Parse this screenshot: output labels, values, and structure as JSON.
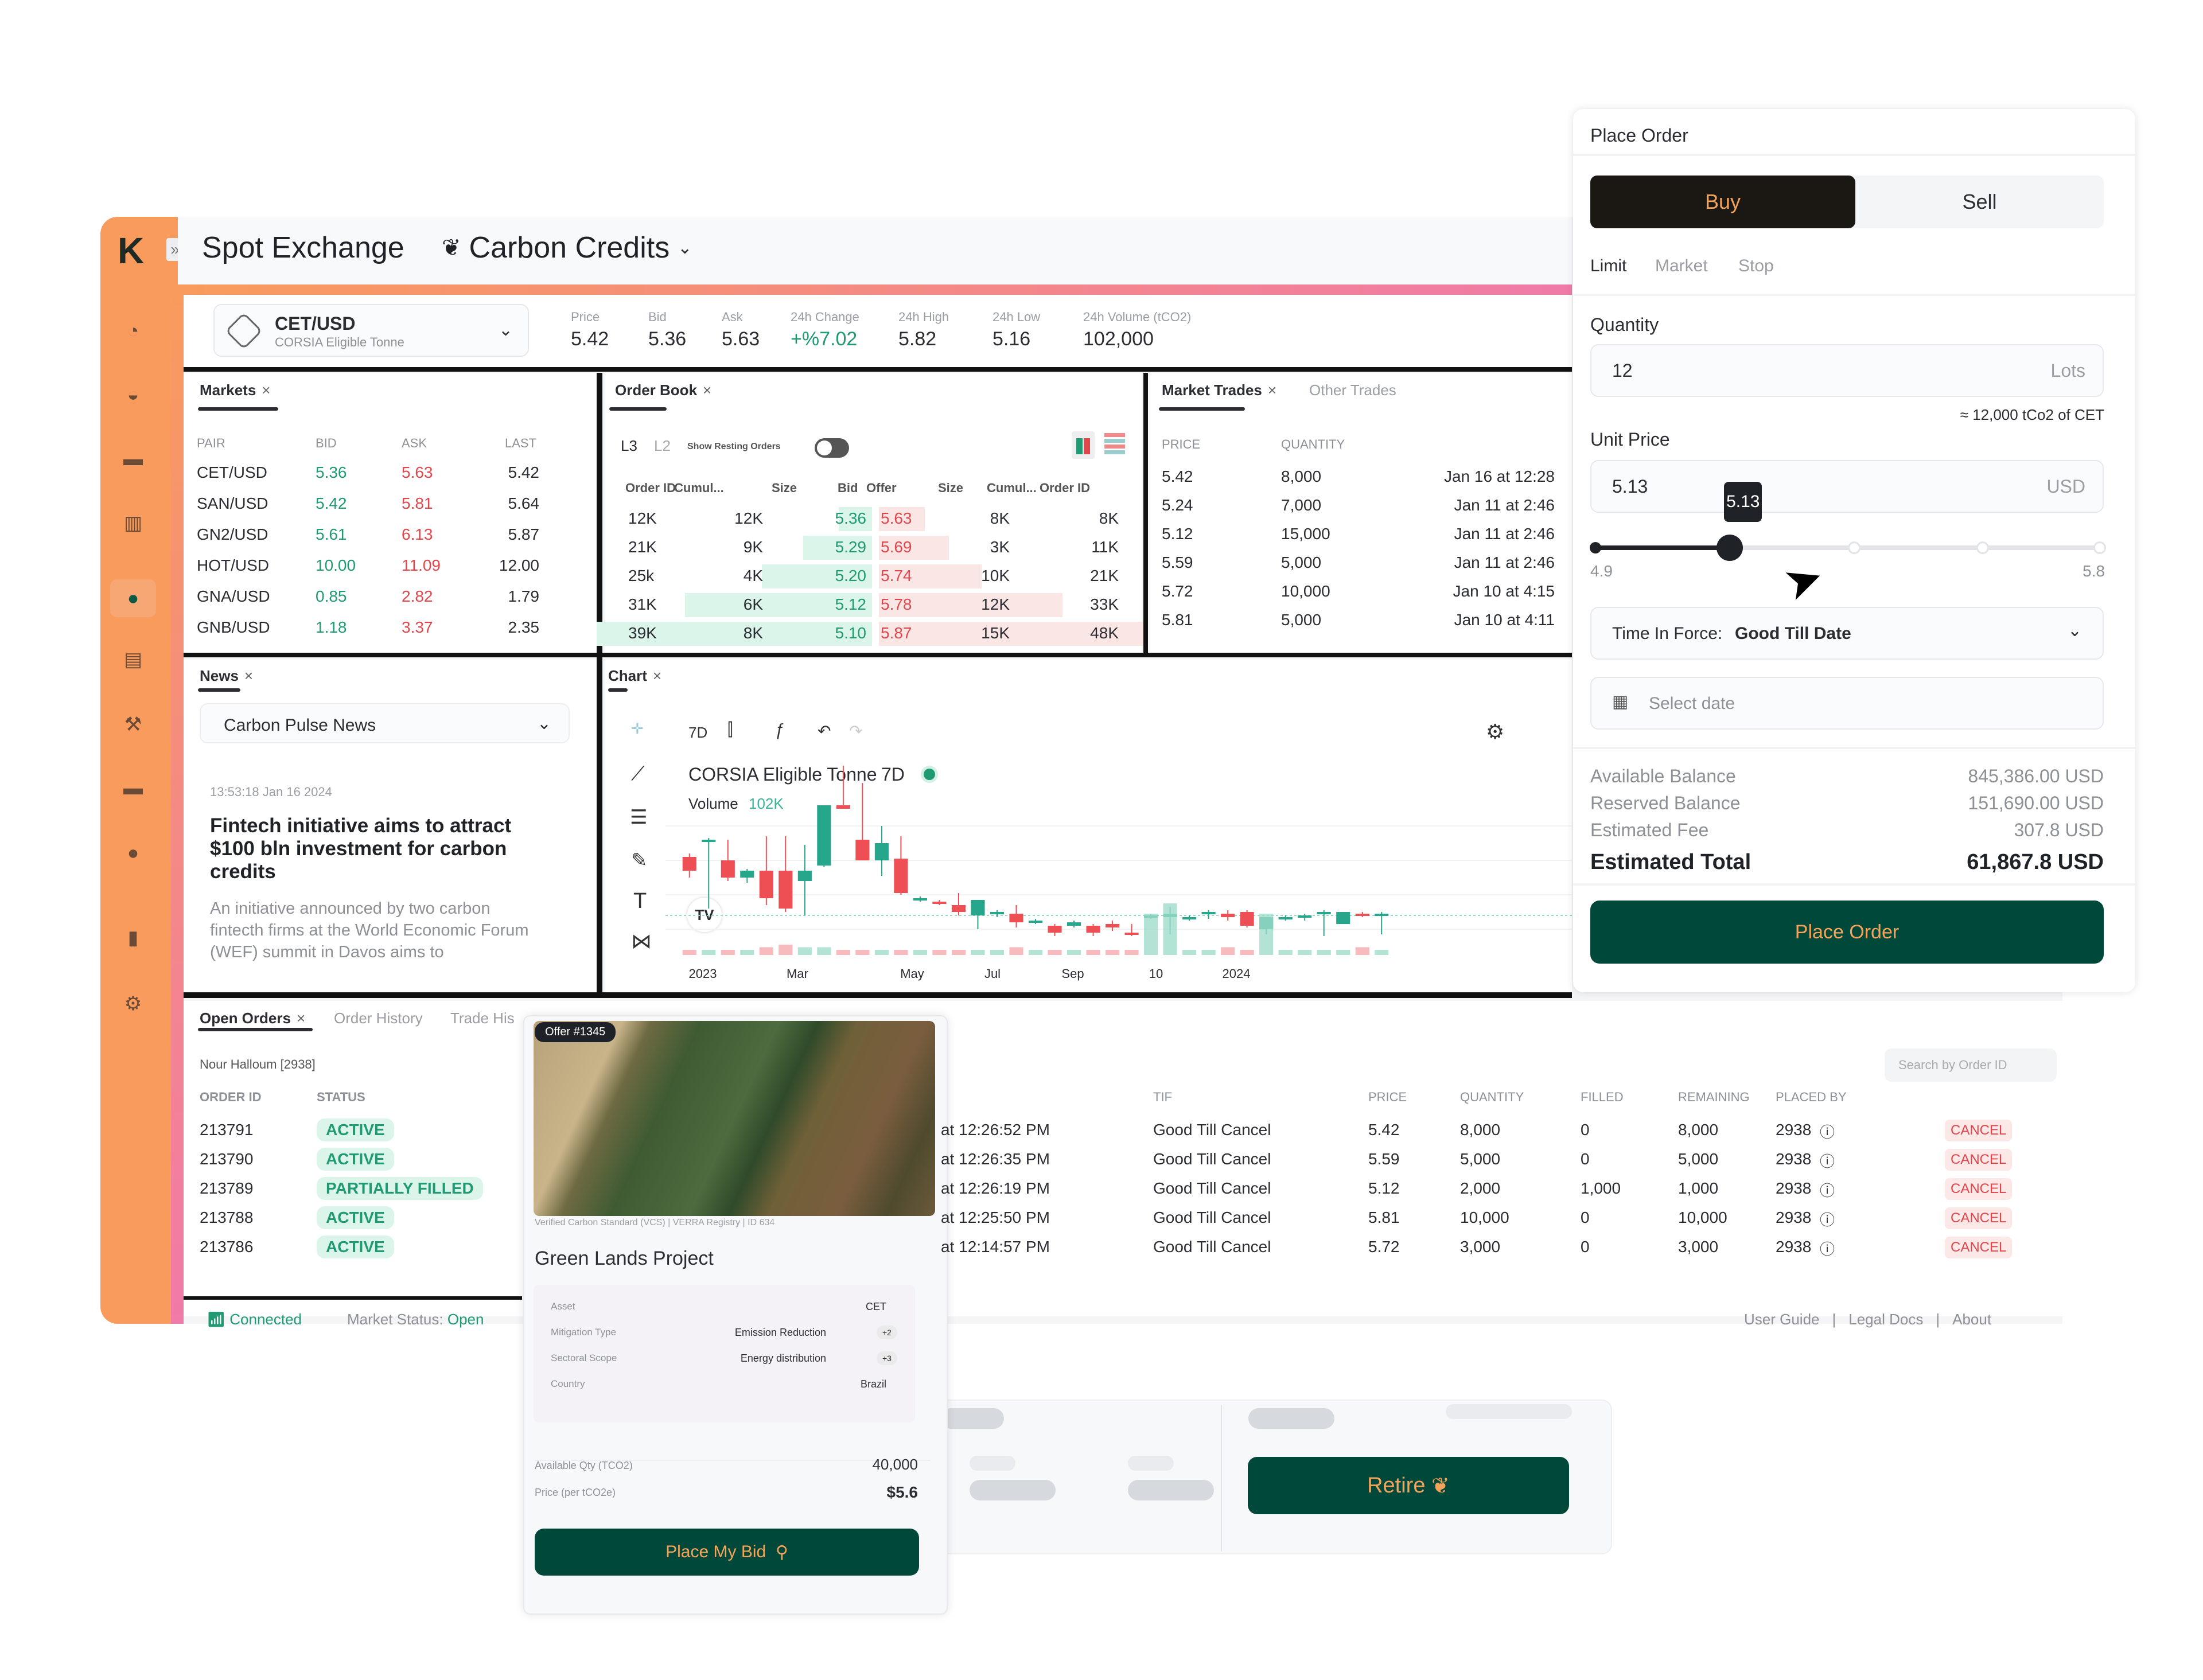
{
  "app": {
    "title": "Spot Exchange",
    "category": "Carbon Credits",
    "logo": "K"
  },
  "sidebar": {
    "items": [
      {
        "icon": "pie-chart-icon"
      },
      {
        "icon": "trend-chat-icon"
      },
      {
        "icon": "wallet-icon"
      },
      {
        "icon": "columns-icon"
      },
      {
        "icon": "globe-exchange-icon",
        "active": true
      },
      {
        "icon": "report-icon"
      },
      {
        "icon": "auction-gavel-icon"
      },
      {
        "icon": "briefcase-icon"
      },
      {
        "icon": "globe-icon"
      },
      {
        "icon": "bar-chart-icon"
      },
      {
        "icon": "settings-gear-icon"
      }
    ]
  },
  "ticker": {
    "pair": "CET/USD",
    "pair_sub": "CORSIA Eligible Tonne",
    "stats": [
      {
        "label": "Price",
        "value": "5.42"
      },
      {
        "label": "Bid",
        "value": "5.36"
      },
      {
        "label": "Ask",
        "value": "5.63"
      },
      {
        "label": "24h Change",
        "value": "+%7.02",
        "positive": true
      },
      {
        "label": "24h High",
        "value": "5.82"
      },
      {
        "label": "24h Low",
        "value": "5.16"
      },
      {
        "label": "24h Volume (tCO2)",
        "value": "102,000"
      }
    ]
  },
  "markets": {
    "tab": "Markets",
    "columns": [
      "PAIR",
      "BID",
      "ASK",
      "LAST"
    ],
    "rows": [
      {
        "pair": "CET/USD",
        "bid": "5.36",
        "ask": "5.63",
        "last": "5.42"
      },
      {
        "pair": "SAN/USD",
        "bid": "5.42",
        "ask": "5.81",
        "last": "5.64"
      },
      {
        "pair": "GN2/USD",
        "bid": "5.61",
        "ask": "6.13",
        "last": "5.87"
      },
      {
        "pair": "HOT/USD",
        "bid": "10.00",
        "ask": "11.09",
        "last": "12.00"
      },
      {
        "pair": "GNA/USD",
        "bid": "0.85",
        "ask": "2.82",
        "last": "1.79"
      },
      {
        "pair": "GNB/USD",
        "bid": "1.18",
        "ask": "3.37",
        "last": "2.35"
      }
    ]
  },
  "order_book": {
    "tab": "Order Book",
    "levels": [
      "L3",
      "L2"
    ],
    "toggle_label": "Show Resting Orders",
    "toggle_on": false,
    "columns": [
      "Order ID",
      "Cumul...",
      "Size",
      "Bid",
      "Offer",
      "Size",
      "Cumul...",
      "Order ID"
    ],
    "rows": [
      {
        "order_id_b": "12K",
        "cumul_b": "12K",
        "size_b": "",
        "bid": "5.36",
        "offer": "5.63",
        "size_a": "8K",
        "cumul_a": "",
        "order_id_a": "8K",
        "bid_depth": 0.12,
        "ask_depth": 0.17
      },
      {
        "order_id_b": "21K",
        "cumul_b": "9K",
        "size_b": "",
        "bid": "5.29",
        "offer": "5.69",
        "size_a": "3K",
        "cumul_a": "",
        "order_id_a": "11K",
        "bid_depth": 0.25,
        "ask_depth": 0.26
      },
      {
        "order_id_b": "25k",
        "cumul_b": "4K",
        "size_b": "",
        "bid": "5.20",
        "offer": "5.74",
        "size_a": "10K",
        "cumul_a": "",
        "order_id_a": "21K",
        "bid_depth": 0.4,
        "ask_depth": 0.38
      },
      {
        "order_id_b": "31K",
        "cumul_b": "6K",
        "size_b": "",
        "bid": "5.12",
        "offer": "5.78",
        "size_a": "12K",
        "cumul_a": "",
        "order_id_a": "33K",
        "bid_depth": 0.68,
        "ask_depth": 0.68
      },
      {
        "order_id_b": "39K",
        "cumul_b": "8K",
        "size_b": "",
        "bid": "5.10",
        "offer": "5.87",
        "size_a": "15K",
        "cumul_a": "",
        "order_id_a": "48K",
        "bid_depth": 1.0,
        "ask_depth": 0.98
      }
    ]
  },
  "market_trades": {
    "tabs": [
      "Market Trades",
      "Other Trades"
    ],
    "columns": [
      "PRICE",
      "QUANTITY"
    ],
    "rows": [
      {
        "price": "5.42",
        "qty": "8,000",
        "time": "Jan 16 at 12:28"
      },
      {
        "price": "5.24",
        "qty": "7,000",
        "time": "Jan 11 at 2:46"
      },
      {
        "price": "5.12",
        "qty": "15,000",
        "time": "Jan 11 at 2:46"
      },
      {
        "price": "5.59",
        "qty": "5,000",
        "time": "Jan 11 at 2:46"
      },
      {
        "price": "5.72",
        "qty": "10,000",
        "time": "Jan 10 at 4:15"
      },
      {
        "price": "5.81",
        "qty": "5,000",
        "time": "Jan 10 at 4:11"
      }
    ]
  },
  "news": {
    "tab": "News",
    "source": "Carbon Pulse News",
    "timestamp": "13:53:18 Jan 16 2024",
    "headline": "Fintech initiative aims to attract $100 bln investment for carbon credits",
    "body": "An initiative announced by two carbon fintecth firms at the World Economic Forum (WEF) summit in Davos aims to"
  },
  "chart_panel": {
    "tab": "Chart",
    "interval": "7D",
    "title": "CORSIA Eligible Tonne",
    "volume_label": "Volume",
    "volume_value": "102K"
  },
  "chart_data": {
    "type": "candlestick",
    "title": "CORSIA Eligible Tonne 7D",
    "x_ticks": [
      "2023",
      "Mar",
      "May",
      "Jul",
      "Sep",
      "10",
      "2024"
    ],
    "y_range": [
      0,
      100
    ],
    "candles": [
      {
        "o": 52,
        "c": 44,
        "h": 54,
        "l": 40,
        "v": 2
      },
      {
        "o": 62,
        "c": 62,
        "h": 63,
        "l": 22,
        "v": 2
      },
      {
        "o": 50,
        "c": 40,
        "h": 62,
        "l": 38,
        "v": 2
      },
      {
        "o": 40,
        "c": 44,
        "h": 45,
        "l": 37,
        "v": 2
      },
      {
        "o": 44,
        "c": 28,
        "h": 64,
        "l": 24,
        "v": 3
      },
      {
        "o": 44,
        "c": 22,
        "h": 64,
        "l": 20,
        "v": 4
      },
      {
        "o": 38,
        "c": 44,
        "h": 59,
        "l": 18,
        "v": 3
      },
      {
        "o": 47,
        "c": 82,
        "h": 82,
        "l": 46,
        "v": 3
      },
      {
        "o": 82,
        "c": 80,
        "h": 105,
        "l": 80,
        "v": 2
      },
      {
        "o": 62,
        "c": 50,
        "h": 95,
        "l": 50,
        "v": 2
      },
      {
        "o": 50,
        "c": 60,
        "h": 70,
        "l": 41,
        "v": 2
      },
      {
        "o": 51,
        "c": 31,
        "h": 64,
        "l": 30,
        "v": 2
      },
      {
        "o": 27,
        "c": 28,
        "h": 29,
        "l": 26,
        "v": 2
      },
      {
        "o": 26,
        "c": 25,
        "h": 27,
        "l": 24,
        "v": 2
      },
      {
        "o": 24,
        "c": 20,
        "h": 31,
        "l": 18,
        "v": 2
      },
      {
        "o": 18,
        "c": 27,
        "h": 27,
        "l": 10,
        "v": 2
      },
      {
        "o": 19,
        "c": 20,
        "h": 21,
        "l": 17,
        "v": 2
      },
      {
        "o": 19,
        "c": 14,
        "h": 24,
        "l": 11,
        "v": 3
      },
      {
        "o": 14,
        "c": 15,
        "h": 16,
        "l": 13,
        "v": 2
      },
      {
        "o": 12,
        "c": 8,
        "h": 13,
        "l": 6,
        "v": 2
      },
      {
        "o": 12,
        "c": 14,
        "h": 15,
        "l": 11,
        "v": 2
      },
      {
        "o": 12,
        "c": 8,
        "h": 13,
        "l": 6,
        "v": 2
      },
      {
        "o": 13,
        "c": 11,
        "h": 15,
        "l": 9,
        "v": 2
      },
      {
        "o": 8,
        "c": 7,
        "h": 13,
        "l": 6,
        "v": 2
      },
      {
        "o": 17,
        "c": 18,
        "h": 19,
        "l": 16,
        "v": 16
      },
      {
        "o": 17,
        "c": 19,
        "h": 23,
        "l": 7,
        "v": 20
      },
      {
        "o": 16,
        "c": 17,
        "h": 18,
        "l": 15,
        "v": 2
      },
      {
        "o": 19,
        "c": 20,
        "h": 21,
        "l": 16,
        "v": 2
      },
      {
        "o": 19,
        "c": 17,
        "h": 21,
        "l": 15,
        "v": 3
      },
      {
        "o": 20,
        "c": 12,
        "h": 21,
        "l": 11,
        "v": 2
      },
      {
        "o": 10,
        "c": 17,
        "h": 17,
        "l": 7,
        "v": 16
      },
      {
        "o": 16,
        "c": 17,
        "h": 18,
        "l": 15,
        "v": 2
      },
      {
        "o": 17,
        "c": 18,
        "h": 19,
        "l": 15,
        "v": 2
      },
      {
        "o": 19,
        "c": 20,
        "h": 21,
        "l": 6,
        "v": 2
      },
      {
        "o": 13,
        "c": 20,
        "h": 20,
        "l": 13,
        "v": 2
      },
      {
        "o": 19,
        "c": 18,
        "h": 20,
        "l": 17,
        "v": 3
      },
      {
        "o": 18,
        "c": 19,
        "h": 20,
        "l": 7,
        "v": 2
      }
    ]
  },
  "place_order": {
    "title": "Place Order",
    "sides": [
      "Buy",
      "Sell"
    ],
    "active_side": "Buy",
    "order_types": [
      "Limit",
      "Market",
      "Stop"
    ],
    "active_type": "Limit",
    "quantity_label": "Quantity",
    "quantity_value": "12",
    "quantity_unit": "Lots",
    "quantity_hint": "≈ 12,000 tCo2 of CET",
    "unit_price_label": "Unit Price",
    "unit_price_value": "5.13",
    "unit_price_currency": "USD",
    "slider": {
      "min": "4.9",
      "max": "5.8",
      "value": "5.13",
      "fraction": 0.27
    },
    "tif_label": "Time In Force:",
    "tif_value": "Good Till Date",
    "date_placeholder": "Select date",
    "balances": [
      {
        "label": "Available Balance",
        "value": "845,386.00 USD"
      },
      {
        "label": "Reserved Balance",
        "value": "151,690.00 USD"
      },
      {
        "label": "Estimated Fee",
        "value": "307.8 USD"
      }
    ],
    "total_label": "Estimated Total",
    "total_value": "61,867.8 USD",
    "submit_label": "Place Order"
  },
  "orders": {
    "tabs": [
      "Open Orders",
      "Order History",
      "Trade His"
    ],
    "user": "Nour Halloum [2938]",
    "search_placeholder": "Search by Order ID",
    "columns": [
      "ORDER ID",
      "STATUS",
      "TIF",
      "PRICE",
      "QUANTITY",
      "FILLED",
      "REMAINING",
      "PLACED BY"
    ],
    "cancel_label": "CANCEL",
    "rows": [
      {
        "id": "213791",
        "status": "ACTIVE",
        "time": "at 12:26:52 PM",
        "tif": "Good Till Cancel",
        "price": "5.42",
        "qty": "8,000",
        "filled": "0",
        "remaining": "8,000",
        "placed_by": "2938"
      },
      {
        "id": "213790",
        "status": "ACTIVE",
        "time": "at 12:26:35 PM",
        "tif": "Good Till Cancel",
        "price": "5.59",
        "qty": "5,000",
        "filled": "0",
        "remaining": "5,000",
        "placed_by": "2938"
      },
      {
        "id": "213789",
        "status": "PARTIALLY FILLED",
        "time": "at 12:26:19 PM",
        "tif": "Good Till Cancel",
        "price": "5.12",
        "qty": "2,000",
        "filled": "1,000",
        "remaining": "1,000",
        "placed_by": "2938"
      },
      {
        "id": "213788",
        "status": "ACTIVE",
        "time": "at 12:25:50 PM",
        "tif": "Good Till Cancel",
        "price": "5.81",
        "qty": "10,000",
        "filled": "0",
        "remaining": "10,000",
        "placed_by": "2938"
      },
      {
        "id": "213786",
        "status": "ACTIVE",
        "time": "at 12:14:57 PM",
        "tif": "Good Till Cancel",
        "price": "5.72",
        "qty": "3,000",
        "filled": "0",
        "remaining": "3,000",
        "placed_by": "2938"
      }
    ]
  },
  "status_bar": {
    "connection": "Connected",
    "market_status_label": "Market Status:",
    "market_status_value": "Open",
    "links": [
      "User Guide",
      "Legal Docs",
      "About"
    ]
  },
  "offer_card": {
    "badge": "Offer #1345",
    "registry": "Verified Carbon Standard (VCS) | VERRA Registry | ID 634",
    "project": "Green Lands Project",
    "attributes": [
      {
        "label": "Asset",
        "value": "CET",
        "extra": ""
      },
      {
        "label": "Mitigation Type",
        "value": "Emission Reduction",
        "extra": "+2"
      },
      {
        "label": "Sectoral Scope",
        "value": "Energy distribution",
        "extra": "+3"
      },
      {
        "label": "Country",
        "value": "Brazil",
        "extra": ""
      }
    ],
    "available_label": "Available Qty (TCO2)",
    "available_value": "40,000",
    "price_label": "Price (per tCO2e)",
    "price_value": "$5.6",
    "bid_button": "Place My Bid"
  },
  "retire_card": {
    "button": "Retire"
  },
  "colors": {
    "sidebar": "#f99b5c",
    "accent_pink": "#f07aa8",
    "primary_green": "#00483a",
    "button_text": "#f4a35a",
    "positive": "#1f9a73",
    "negative": "#e0474c"
  }
}
